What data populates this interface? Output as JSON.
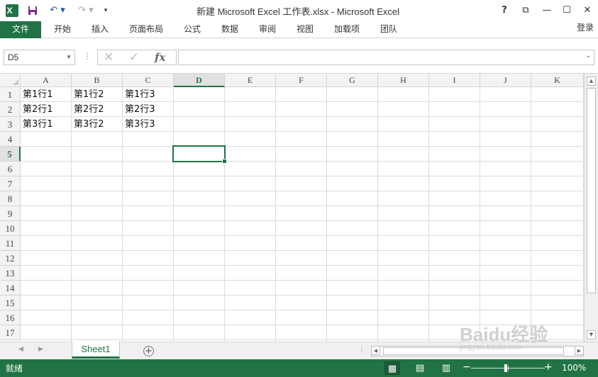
{
  "titlebar": {
    "title": "新建 Microsoft Excel 工作表.xlsx - Microsoft Excel",
    "help": "?",
    "ribbon_display": "⧉",
    "minimize": "—",
    "maximize": "☐",
    "close": "✕"
  },
  "ribbon": {
    "file": "文件",
    "tabs": [
      "开始",
      "插入",
      "页面布局",
      "公式",
      "数据",
      "审阅",
      "视图",
      "加载项",
      "团队"
    ],
    "login": "登录"
  },
  "formula_bar": {
    "name_box": "D5",
    "cancel": "✕",
    "enter": "✓",
    "fx": "fx",
    "formula": ""
  },
  "grid": {
    "columns": [
      "A",
      "B",
      "C",
      "D",
      "E",
      "F",
      "G",
      "H",
      "I",
      "J",
      "K"
    ],
    "selected_column": "D",
    "rows": [
      "1",
      "2",
      "3",
      "4",
      "5",
      "6",
      "7",
      "8",
      "9",
      "10",
      "11",
      "12",
      "13",
      "14",
      "15",
      "16",
      "17"
    ],
    "selected_row": "5",
    "cells": [
      [
        "第1行1",
        "第1行2",
        "第1行3"
      ],
      [
        "第2行1",
        "第2行2",
        "第2行3"
      ],
      [
        "第3行1",
        "第3行2",
        "第3行3"
      ]
    ]
  },
  "sheets": {
    "tabs": [
      "Sheet1"
    ],
    "add": "+"
  },
  "status": {
    "text": "就绪",
    "zoom": "100%",
    "zoom_percent": 100
  },
  "watermark": {
    "brand": "Baidu经验",
    "url": "jingyan.baidu.com"
  }
}
